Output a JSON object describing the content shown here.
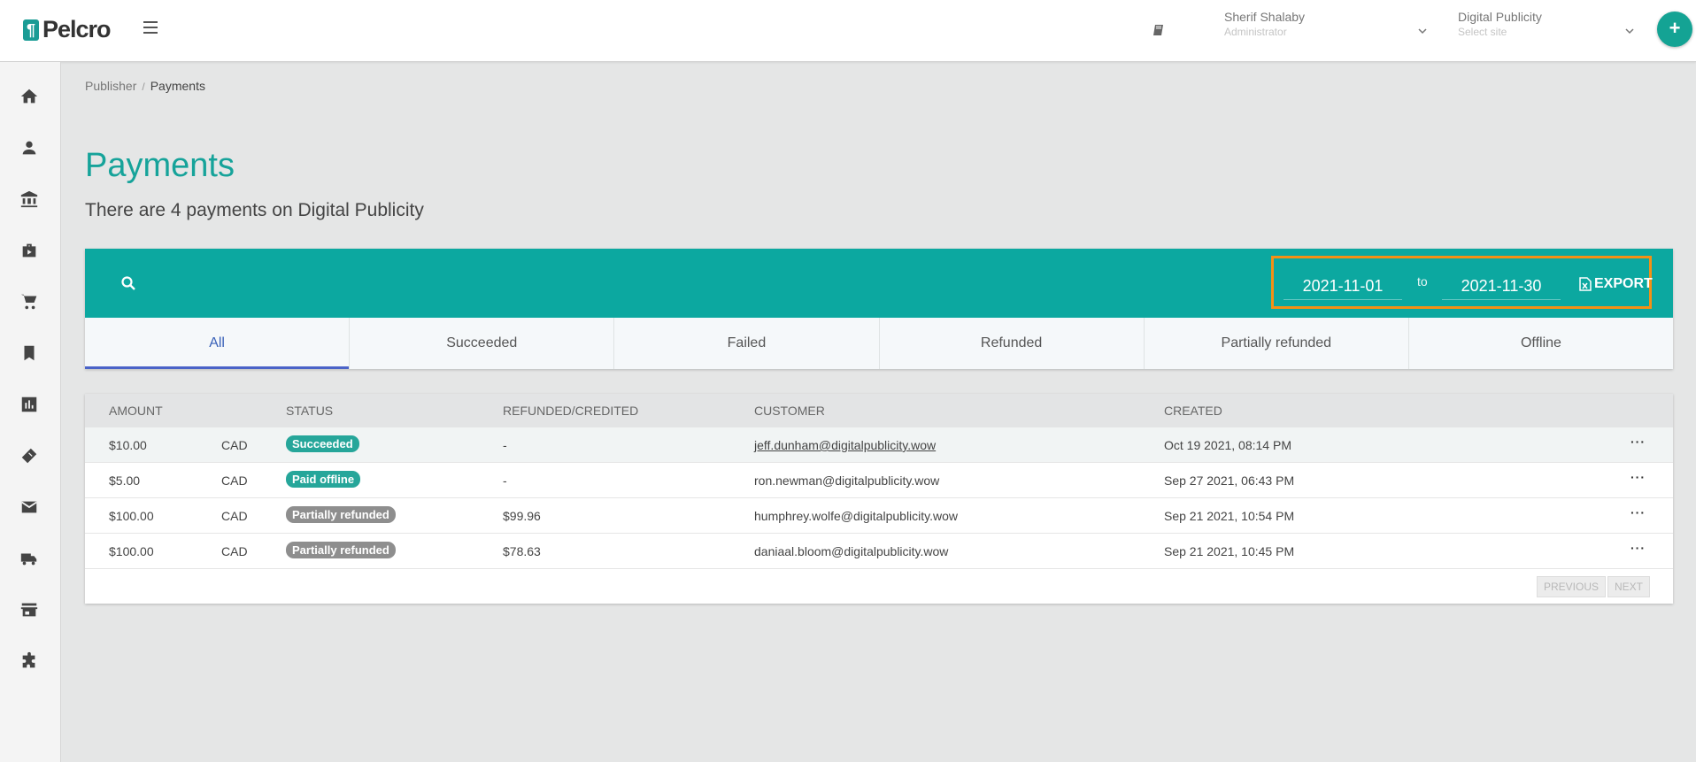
{
  "brand": {
    "mark": "¶",
    "name": "Pelcro"
  },
  "header": {
    "user": {
      "name": "Sherif Shalaby",
      "role": "Administrator"
    },
    "site": {
      "name": "Digital Publicity",
      "placeholder": "Select site"
    },
    "add_label": "+"
  },
  "sidebar": {
    "items": [
      {
        "icon": "home-icon"
      },
      {
        "icon": "person-icon"
      },
      {
        "icon": "bank-icon"
      },
      {
        "icon": "briefcase-icon"
      },
      {
        "icon": "cart-icon"
      },
      {
        "icon": "bookmark-icon"
      },
      {
        "icon": "bar-chart-icon"
      },
      {
        "icon": "ticket-icon"
      },
      {
        "icon": "mail-icon"
      },
      {
        "icon": "truck-icon"
      },
      {
        "icon": "store-icon"
      },
      {
        "icon": "puzzle-icon"
      }
    ]
  },
  "breadcrumb": {
    "parent": "Publisher",
    "separator": "/",
    "current": "Payments"
  },
  "page": {
    "title": "Payments",
    "subtitle": "There are 4 payments on Digital Publicity"
  },
  "filters": {
    "date_from": "2021-11-01",
    "to_label": "to",
    "date_to": "2021-11-30",
    "export_label": "EXPORT"
  },
  "tabs": [
    {
      "label": "All",
      "active": true
    },
    {
      "label": "Succeeded"
    },
    {
      "label": "Failed"
    },
    {
      "label": "Refunded"
    },
    {
      "label": "Partially refunded"
    },
    {
      "label": "Offline"
    }
  ],
  "table": {
    "columns": [
      "AMOUNT",
      "STATUS",
      "REFUNDED/CREDITED",
      "CUSTOMER",
      "CREATED"
    ],
    "rows": [
      {
        "amount": "$10.00",
        "currency": "CAD",
        "status": "Succeeded",
        "status_color": "#26a69a",
        "refunded": "-",
        "customer": "jeff.dunham@digitalpublicity.wow",
        "created": "Oct 19 2021, 08:14 PM",
        "more": "···"
      },
      {
        "amount": "$5.00",
        "currency": "CAD",
        "status": "Paid offline",
        "status_color": "#26a69a",
        "refunded": "-",
        "customer": "ron.newman@digitalpublicity.wow",
        "created": "Sep 27 2021, 06:43 PM",
        "more": "···"
      },
      {
        "amount": "$100.00",
        "currency": "CAD",
        "status": "Partially refunded",
        "status_color": "#8e8e8e",
        "refunded": "$99.96",
        "customer": "humphrey.wolfe@digitalpublicity.wow",
        "created": "Sep 21 2021, 10:54 PM",
        "more": "···"
      },
      {
        "amount": "$100.00",
        "currency": "CAD",
        "status": "Partially refunded",
        "status_color": "#8e8e8e",
        "refunded": "$78.63",
        "customer": "daniaal.bloom@digitalpublicity.wow",
        "created": "Sep 21 2021, 10:45 PM",
        "more": "···"
      }
    ],
    "pagination": {
      "previous": "PREVIOUS",
      "next": "NEXT"
    }
  },
  "colors": {
    "accent": "#0ca8a0",
    "title": "#16a39a",
    "highlight": "#f59014",
    "active_tab": "#4a63c8"
  }
}
